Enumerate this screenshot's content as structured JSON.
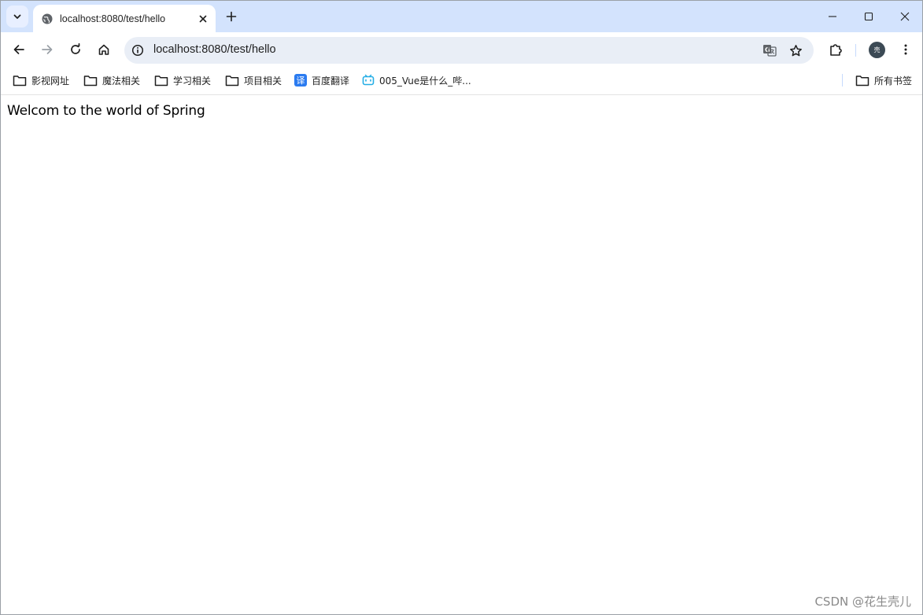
{
  "tab": {
    "title": "localhost:8080/test/hello"
  },
  "omnibox": {
    "url": "localhost:8080/test/hello"
  },
  "profile": {
    "avatar_char": "壳"
  },
  "bookmarks": [
    {
      "label": "影视网址",
      "icon": "folder-icon"
    },
    {
      "label": "魔法相关",
      "icon": "folder-icon"
    },
    {
      "label": "学习相关",
      "icon": "folder-icon"
    },
    {
      "label": "项目相关",
      "icon": "folder-icon"
    },
    {
      "label": "百度翻译",
      "icon": "baidu-translate-icon",
      "icon_char": "译"
    },
    {
      "label": "005_Vue是什么_哔...",
      "icon": "bilibili-icon"
    }
  ],
  "all_bookmarks": {
    "label": "所有书签",
    "icon": "folder-icon"
  },
  "page": {
    "text": "Welcom to the world of Spring"
  },
  "watermark": "CSDN @花生壳儿",
  "colors": {
    "tabstrip": "#d3e3fd",
    "omnibox": "#e9eef6",
    "baidu": "#2b7bf0",
    "bilibili": "#23ade5"
  }
}
